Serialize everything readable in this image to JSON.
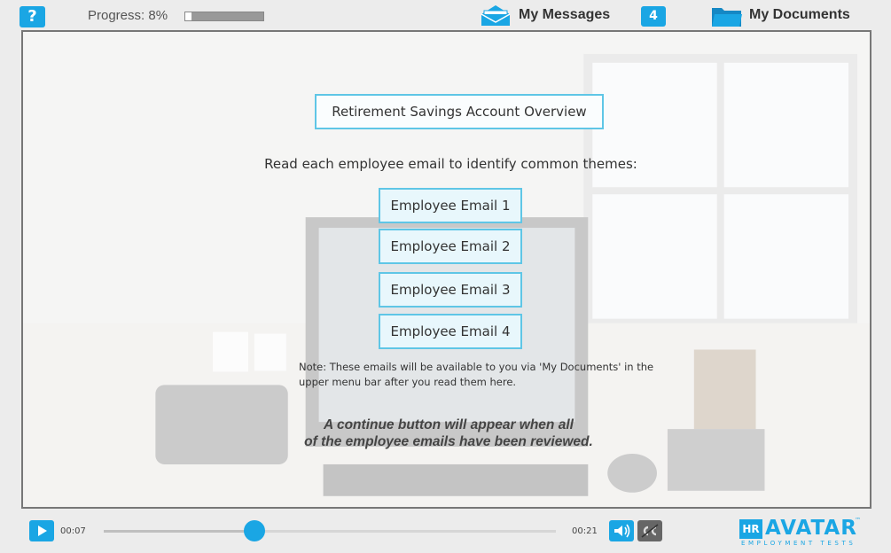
{
  "header": {
    "help_label": "?",
    "progress_label": "Progress: 8%",
    "progress_value": 0.08,
    "messages_label": "My Messages",
    "messages_count": "4",
    "documents_label": "My Documents"
  },
  "main": {
    "title": "Retirement Savings Account Overview",
    "instruction": "Read each employee email to identify common themes:",
    "emails": [
      {
        "label": "Employee Email 1"
      },
      {
        "label": "Employee Email 2"
      },
      {
        "label": "Employee Email 3"
      },
      {
        "label": "Employee Email 4"
      }
    ],
    "note_line1": "Note: These emails will be available to you via 'My Documents' in the",
    "note_line2": "upper menu bar after you read them here.",
    "continue_line1": "A continue button will appear when all",
    "continue_line2": "of the employee emails have been reviewed."
  },
  "player": {
    "current_time": "00:07",
    "total_time": "00:21",
    "position": 0.333
  },
  "logo": {
    "hr": "HR",
    "name": "AVATAR",
    "tm": "™",
    "tagline": "EMPLOYMENT TESTS"
  },
  "colors": {
    "accent": "#1aa6e4",
    "button_border": "#5fc6e6",
    "button_fill": "#e8f7fc"
  },
  "icons": [
    "help-icon",
    "envelope-icon",
    "folder-icon",
    "play-icon",
    "volume-icon",
    "captions-icon"
  ]
}
